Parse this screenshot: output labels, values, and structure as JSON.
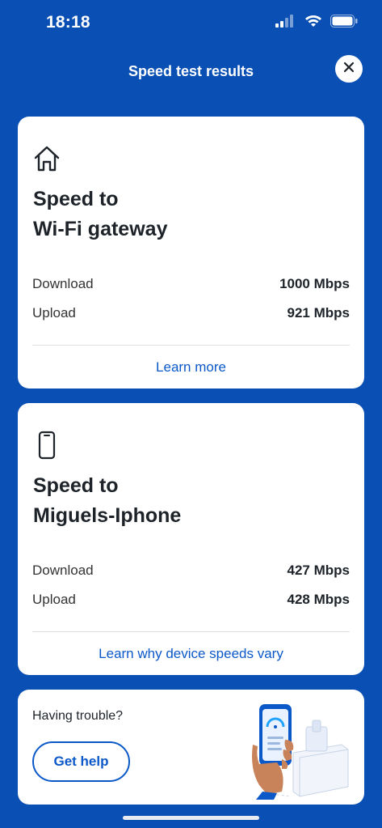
{
  "status_bar": {
    "time": "18:18"
  },
  "header": {
    "title": "Speed test results"
  },
  "gateway_card": {
    "title_line1": "Speed to",
    "title_line2": "Wi-Fi gateway",
    "download_label": "Download",
    "download_value": "1000 Mbps",
    "upload_label": "Upload",
    "upload_value": "921 Mbps",
    "link": "Learn more"
  },
  "device_card": {
    "title_line1": "Speed to",
    "title_line2": "Miguels-Iphone",
    "download_label": "Download",
    "download_value": "427 Mbps",
    "upload_label": "Upload",
    "upload_value": "428 Mbps",
    "link": "Learn why device speeds vary"
  },
  "trouble_card": {
    "text": "Having trouble?",
    "button": "Get help"
  },
  "colors": {
    "background": "#0a4fb3",
    "accent": "#0b58c9"
  },
  "icons": [
    "signal-icon",
    "wifi-icon",
    "battery-icon",
    "close-icon",
    "home-icon",
    "phone-icon"
  ]
}
